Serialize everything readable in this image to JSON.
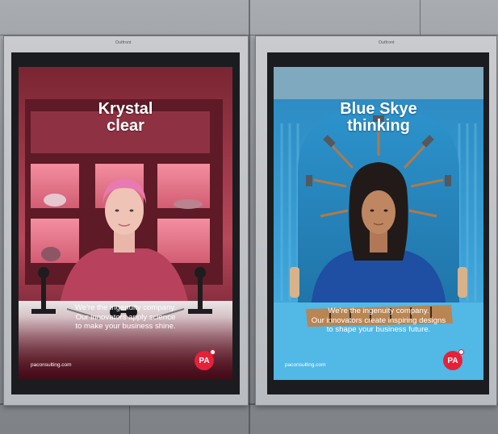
{
  "posters": [
    {
      "headline": [
        "Krystal",
        "clear"
      ],
      "body": [
        "We're the ingenuity company.",
        "Our innovators apply science",
        "to make your business shine."
      ],
      "url": "paconsulting.com",
      "logo": "PA",
      "brand_tag": "Outfront"
    },
    {
      "headline": [
        "Blue Skye",
        "thinking"
      ],
      "body": [
        "We're the ingenuity company.",
        "Our innovators create inspiring designs",
        "to shape your business future."
      ],
      "url": "paconsulting.com",
      "logo": "PA",
      "brand_tag": "Outfront"
    }
  ],
  "colors": {
    "left_bg": "#8a2d3c",
    "right_bg": "#2f8fc0",
    "logo": "#e5213a"
  }
}
